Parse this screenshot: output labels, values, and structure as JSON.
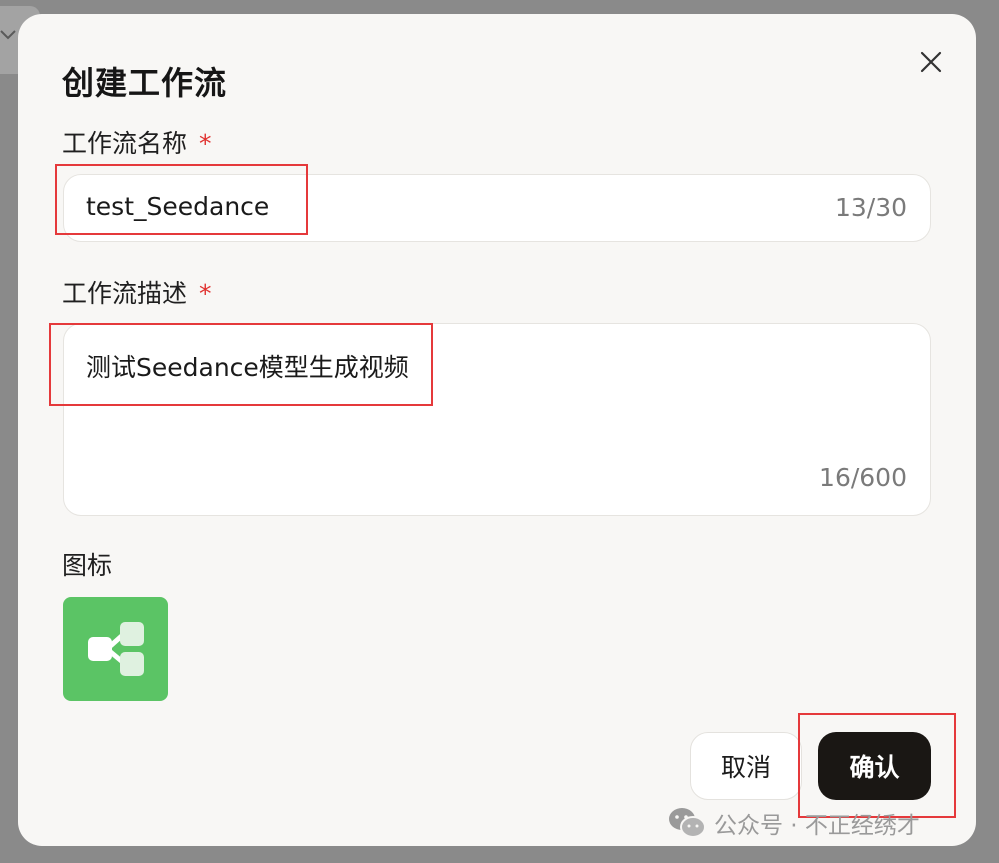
{
  "dialog": {
    "title": "创建工作流",
    "close_icon": "close-icon"
  },
  "fields": {
    "name": {
      "label": "工作流名称",
      "required_mark": "*",
      "value": "test_Seedance",
      "counter": "13/30"
    },
    "description": {
      "label": "工作流描述",
      "required_mark": "*",
      "value": "测试Seedance模型生成视频",
      "counter": "16/600"
    },
    "icon": {
      "label": "图标",
      "icon_name": "workflow-icon",
      "color": "#5bc465"
    }
  },
  "buttons": {
    "cancel": "取消",
    "confirm": "确认"
  },
  "watermark": {
    "text": "公众号 · 不正经绣才"
  },
  "colors": {
    "highlight": "#e5393b",
    "required": "#e0312f",
    "confirm_bg": "#1a1714"
  }
}
